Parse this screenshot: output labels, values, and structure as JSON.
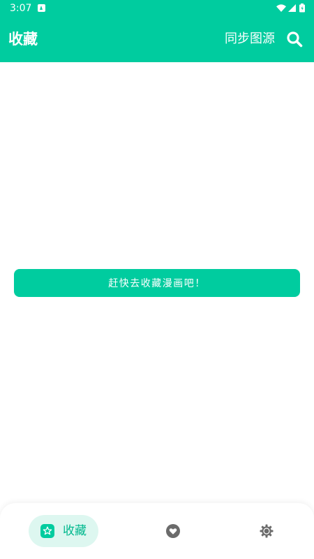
{
  "status_bar": {
    "time": "3:07",
    "icons": [
      "notification-a-icon",
      "wifi-icon",
      "signal-icon",
      "battery-icon"
    ]
  },
  "app_bar": {
    "title": "收藏",
    "sync_label": "同步图源",
    "search_icon": "search-icon"
  },
  "main": {
    "empty_action_label": "赶快去收藏漫画吧！"
  },
  "bottom_nav": {
    "items": [
      {
        "label": "收藏",
        "icon": "star-icon",
        "active": true
      },
      {
        "label": "",
        "icon": "heart-icon",
        "active": false
      },
      {
        "label": "",
        "icon": "settings-icon",
        "active": false
      }
    ]
  },
  "colors": {
    "accent": "#00CC9F",
    "accent_light": "#DDF7F0",
    "icon_gray": "#6B6B6B"
  }
}
